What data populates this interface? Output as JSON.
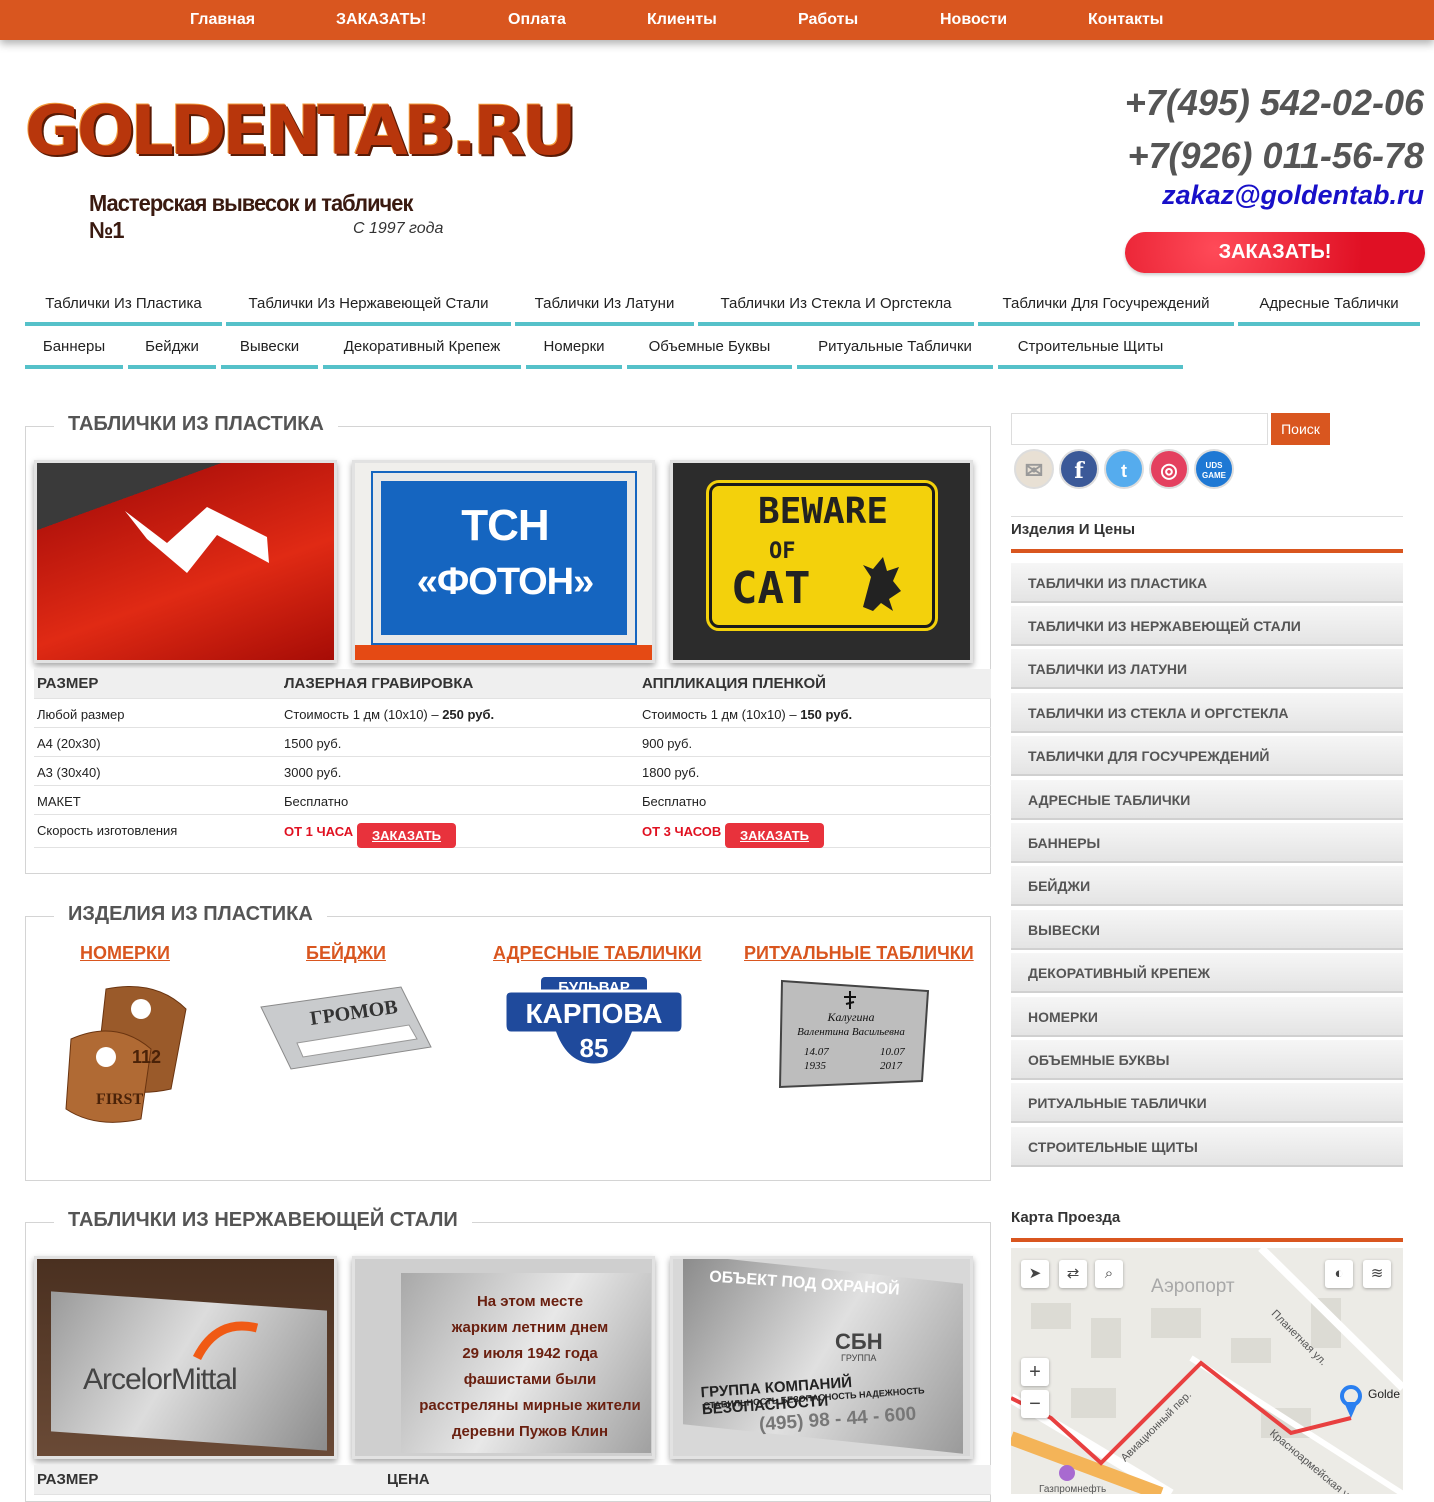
{
  "topnav": [
    "Главная",
    "ЗАКАЗАТЬ!",
    "Оплата",
    "Клиенты",
    "Работы",
    "Новости",
    "Контакты"
  ],
  "logo": {
    "main": "GOLDENTAB.RU",
    "sub": "Мастерская вывесок и табличек №1",
    "since": "С 1997 года"
  },
  "contacts": {
    "phone1": "+7(495) 542-02-06",
    "phone2": "+7(926) 011-56-78",
    "email": "zakaz@goldentab.ru",
    "order_label": "ЗАКАЗАТЬ!"
  },
  "categories_row1": [
    "Таблички Из Пластика",
    "Таблички Из Нержавеющей Стали",
    "Таблички Из Латуни",
    "Таблички Из Стекла И Оргстекла",
    "Таблички Для Госучреждений",
    "Адресные Таблички"
  ],
  "categories_row2": [
    "Баннеры",
    "Бейджи",
    "Вывески",
    "Декоративный Крепеж",
    "Номерки",
    "Объемные Буквы",
    "Ритуальные Таблички",
    "Строительные Щиты"
  ],
  "plastic": {
    "title": "ТАБЛИЧКИ ИЗ ПЛАСТИКА",
    "photo_texts": {
      "tsn1": "ТСН",
      "tsn2": "«ФОТОН»",
      "beware1": "BEWARE",
      "beware2": "OF",
      "beware3": "CAT"
    },
    "headers": [
      "РАЗМЕР",
      "ЛАЗЕРНАЯ ГРАВИРОВКА",
      "АППЛИКАЦИЯ ПЛЕНКОЙ"
    ],
    "rows": [
      {
        "size": "Любой размер",
        "laser_pre": "Стоимость 1 дм (10х10) – ",
        "laser_bold": "250 руб.",
        "film_pre": "Стоимость 1 дм (10х10) – ",
        "film_bold": "150 руб."
      },
      {
        "size": "А4 (20х30)",
        "laser": "1500 руб.",
        "film": "900 руб."
      },
      {
        "size": "А3 (30х40)",
        "laser": "3000 руб.",
        "film": "1800 руб."
      },
      {
        "size": "МАКЕТ",
        "laser": "Бесплатно",
        "film": "Бесплатно"
      },
      {
        "size": "Скорость изготовления",
        "laser_speed": "ОТ 1 ЧАСА",
        "film_speed": "ОТ 3 ЧАСОВ",
        "order": "ЗАКАЗАТЬ"
      }
    ]
  },
  "products": {
    "title": "ИЗДЕЛИЯ ИЗ ПЛАСТИКА",
    "items": [
      "НОМЕРКИ",
      "БЕЙДЖИ",
      "АДРЕСНЫЕ ТАБЛИЧКИ",
      "РИТУАЛЬНЫЕ ТАБЛИЧКИ"
    ],
    "photo_texts": {
      "tag": "112",
      "tag2": "FIRST",
      "badge": "ГРОМОВ",
      "street1": "БУЛЬВАР",
      "street2": "КАРПОВА",
      "street3": "85",
      "ritual1": "Калугина",
      "ritual2": "Валентина Васильевна",
      "ritual3": "14.07",
      "ritual4": "1935",
      "ritual5": "10.07",
      "ritual6": "2017"
    }
  },
  "steel": {
    "title": "ТАБЛИЧКИ ИЗ НЕРЖАВЕЮЩЕЙ СТАЛИ",
    "headers": [
      "РАЗМЕР",
      "ЦЕНА"
    ],
    "photo_texts": {
      "arcelor": "ArcelorMittal",
      "memorial": [
        "На этом месте",
        "жарким летним днем",
        "29 июля 1942 года",
        "фашистами были",
        "расстреляны мирные жители",
        "деревни Пужов Клин"
      ],
      "sec1": "ОБЪЕКТ ПОД ОХРАНОЙ",
      "sec2": "СБН",
      "sec3": "ГРУППА",
      "sec4": "ГРУППА КОМПАНИЙ БЕЗОПАСНОСТИ",
      "sec5": "СТАБИЛЬНОСТЬ БЕЗОПАСНОСТЬ НАДЕЖНОСТЬ",
      "sec6": "(495) 98 - 44 - 600"
    }
  },
  "sidebar": {
    "search_button": "Поиск",
    "social": [
      "mail-icon",
      "facebook-icon",
      "twitter-icon",
      "instagram-icon",
      "uds-game-icon"
    ],
    "uds_label": "UDS GAME",
    "products_heading": "Изделия И Цены",
    "menu": [
      "ТАБЛИЧКИ ИЗ ПЛАСТИКА",
      "ТАБЛИЧКИ ИЗ НЕРЖАВЕЮЩЕЙ СТАЛИ",
      "ТАБЛИЧКИ ИЗ ЛАТУНИ",
      "ТАБЛИЧКИ ИЗ СТЕКЛА И ОРГСТЕКЛА",
      "ТАБЛИЧКИ ДЛЯ ГОСУЧРЕЖДЕНИЙ",
      "АДРЕСНЫЕ ТАБЛИЧКИ",
      "БАННЕРЫ",
      "БЕЙДЖИ",
      "ВЫВЕСКИ",
      "ДЕКОРАТИВНЫЙ КРЕПЕЖ",
      "НОМЕРКИ",
      "ОБЪЕМНЫЕ БУКВЫ",
      "РИТУАЛЬНЫЕ ТАБЛИЧКИ",
      "СТРОИТЕЛЬНЫЕ ЩИТЫ"
    ],
    "map_heading": "Карта Проезда",
    "map": {
      "district": "Аэропорт",
      "street1": "Планетная ул.",
      "street2": "Авиационный пер.",
      "street3": "Красноармейская ул.",
      "poi": "Газпромнефть",
      "place": "Golde",
      "zoom_in": "+",
      "zoom_out": "−"
    }
  },
  "colors": {
    "accent": "#d9561f",
    "teal": "#55c1c9",
    "red": "#e01020",
    "email": "#1810c8"
  }
}
